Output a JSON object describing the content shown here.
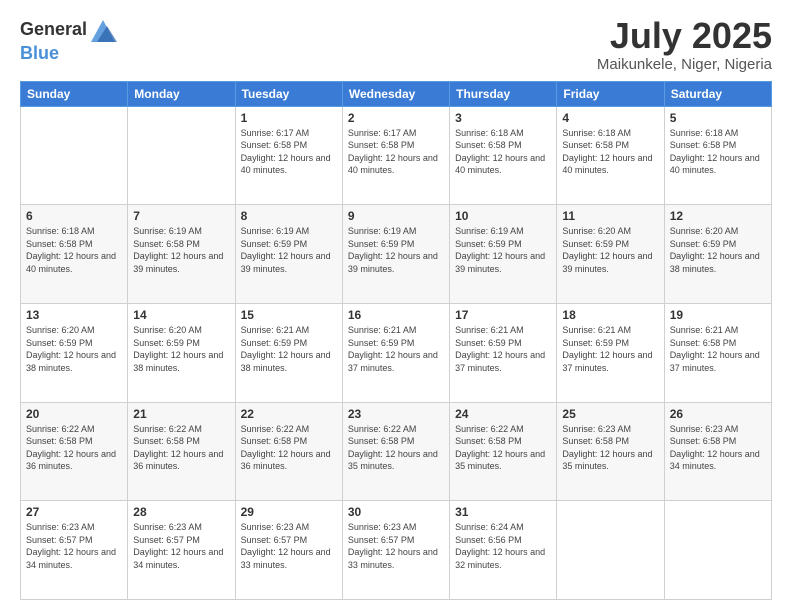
{
  "header": {
    "logo_general": "General",
    "logo_blue": "Blue",
    "month_title": "July 2025",
    "location": "Maikunkele, Niger, Nigeria"
  },
  "weekdays": [
    "Sunday",
    "Monday",
    "Tuesday",
    "Wednesday",
    "Thursday",
    "Friday",
    "Saturday"
  ],
  "weeks": [
    [
      {
        "day": "",
        "sunrise": "",
        "sunset": "",
        "daylight": ""
      },
      {
        "day": "",
        "sunrise": "",
        "sunset": "",
        "daylight": ""
      },
      {
        "day": "1",
        "sunrise": "Sunrise: 6:17 AM",
        "sunset": "Sunset: 6:58 PM",
        "daylight": "Daylight: 12 hours and 40 minutes."
      },
      {
        "day": "2",
        "sunrise": "Sunrise: 6:17 AM",
        "sunset": "Sunset: 6:58 PM",
        "daylight": "Daylight: 12 hours and 40 minutes."
      },
      {
        "day": "3",
        "sunrise": "Sunrise: 6:18 AM",
        "sunset": "Sunset: 6:58 PM",
        "daylight": "Daylight: 12 hours and 40 minutes."
      },
      {
        "day": "4",
        "sunrise": "Sunrise: 6:18 AM",
        "sunset": "Sunset: 6:58 PM",
        "daylight": "Daylight: 12 hours and 40 minutes."
      },
      {
        "day": "5",
        "sunrise": "Sunrise: 6:18 AM",
        "sunset": "Sunset: 6:58 PM",
        "daylight": "Daylight: 12 hours and 40 minutes."
      }
    ],
    [
      {
        "day": "6",
        "sunrise": "Sunrise: 6:18 AM",
        "sunset": "Sunset: 6:58 PM",
        "daylight": "Daylight: 12 hours and 40 minutes."
      },
      {
        "day": "7",
        "sunrise": "Sunrise: 6:19 AM",
        "sunset": "Sunset: 6:58 PM",
        "daylight": "Daylight: 12 hours and 39 minutes."
      },
      {
        "day": "8",
        "sunrise": "Sunrise: 6:19 AM",
        "sunset": "Sunset: 6:59 PM",
        "daylight": "Daylight: 12 hours and 39 minutes."
      },
      {
        "day": "9",
        "sunrise": "Sunrise: 6:19 AM",
        "sunset": "Sunset: 6:59 PM",
        "daylight": "Daylight: 12 hours and 39 minutes."
      },
      {
        "day": "10",
        "sunrise": "Sunrise: 6:19 AM",
        "sunset": "Sunset: 6:59 PM",
        "daylight": "Daylight: 12 hours and 39 minutes."
      },
      {
        "day": "11",
        "sunrise": "Sunrise: 6:20 AM",
        "sunset": "Sunset: 6:59 PM",
        "daylight": "Daylight: 12 hours and 39 minutes."
      },
      {
        "day": "12",
        "sunrise": "Sunrise: 6:20 AM",
        "sunset": "Sunset: 6:59 PM",
        "daylight": "Daylight: 12 hours and 38 minutes."
      }
    ],
    [
      {
        "day": "13",
        "sunrise": "Sunrise: 6:20 AM",
        "sunset": "Sunset: 6:59 PM",
        "daylight": "Daylight: 12 hours and 38 minutes."
      },
      {
        "day": "14",
        "sunrise": "Sunrise: 6:20 AM",
        "sunset": "Sunset: 6:59 PM",
        "daylight": "Daylight: 12 hours and 38 minutes."
      },
      {
        "day": "15",
        "sunrise": "Sunrise: 6:21 AM",
        "sunset": "Sunset: 6:59 PM",
        "daylight": "Daylight: 12 hours and 38 minutes."
      },
      {
        "day": "16",
        "sunrise": "Sunrise: 6:21 AM",
        "sunset": "Sunset: 6:59 PM",
        "daylight": "Daylight: 12 hours and 37 minutes."
      },
      {
        "day": "17",
        "sunrise": "Sunrise: 6:21 AM",
        "sunset": "Sunset: 6:59 PM",
        "daylight": "Daylight: 12 hours and 37 minutes."
      },
      {
        "day": "18",
        "sunrise": "Sunrise: 6:21 AM",
        "sunset": "Sunset: 6:59 PM",
        "daylight": "Daylight: 12 hours and 37 minutes."
      },
      {
        "day": "19",
        "sunrise": "Sunrise: 6:21 AM",
        "sunset": "Sunset: 6:58 PM",
        "daylight": "Daylight: 12 hours and 37 minutes."
      }
    ],
    [
      {
        "day": "20",
        "sunrise": "Sunrise: 6:22 AM",
        "sunset": "Sunset: 6:58 PM",
        "daylight": "Daylight: 12 hours and 36 minutes."
      },
      {
        "day": "21",
        "sunrise": "Sunrise: 6:22 AM",
        "sunset": "Sunset: 6:58 PM",
        "daylight": "Daylight: 12 hours and 36 minutes."
      },
      {
        "day": "22",
        "sunrise": "Sunrise: 6:22 AM",
        "sunset": "Sunset: 6:58 PM",
        "daylight": "Daylight: 12 hours and 36 minutes."
      },
      {
        "day": "23",
        "sunrise": "Sunrise: 6:22 AM",
        "sunset": "Sunset: 6:58 PM",
        "daylight": "Daylight: 12 hours and 35 minutes."
      },
      {
        "day": "24",
        "sunrise": "Sunrise: 6:22 AM",
        "sunset": "Sunset: 6:58 PM",
        "daylight": "Daylight: 12 hours and 35 minutes."
      },
      {
        "day": "25",
        "sunrise": "Sunrise: 6:23 AM",
        "sunset": "Sunset: 6:58 PM",
        "daylight": "Daylight: 12 hours and 35 minutes."
      },
      {
        "day": "26",
        "sunrise": "Sunrise: 6:23 AM",
        "sunset": "Sunset: 6:58 PM",
        "daylight": "Daylight: 12 hours and 34 minutes."
      }
    ],
    [
      {
        "day": "27",
        "sunrise": "Sunrise: 6:23 AM",
        "sunset": "Sunset: 6:57 PM",
        "daylight": "Daylight: 12 hours and 34 minutes."
      },
      {
        "day": "28",
        "sunrise": "Sunrise: 6:23 AM",
        "sunset": "Sunset: 6:57 PM",
        "daylight": "Daylight: 12 hours and 34 minutes."
      },
      {
        "day": "29",
        "sunrise": "Sunrise: 6:23 AM",
        "sunset": "Sunset: 6:57 PM",
        "daylight": "Daylight: 12 hours and 33 minutes."
      },
      {
        "day": "30",
        "sunrise": "Sunrise: 6:23 AM",
        "sunset": "Sunset: 6:57 PM",
        "daylight": "Daylight: 12 hours and 33 minutes."
      },
      {
        "day": "31",
        "sunrise": "Sunrise: 6:24 AM",
        "sunset": "Sunset: 6:56 PM",
        "daylight": "Daylight: 12 hours and 32 minutes."
      },
      {
        "day": "",
        "sunrise": "",
        "sunset": "",
        "daylight": ""
      },
      {
        "day": "",
        "sunrise": "",
        "sunset": "",
        "daylight": ""
      }
    ]
  ]
}
